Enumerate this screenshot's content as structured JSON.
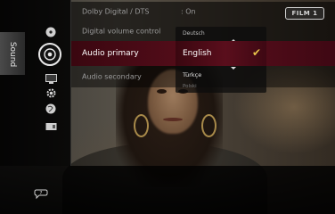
{
  "sidebar": {
    "label": "Sound",
    "categories": [
      {
        "icon": "disc-icon"
      },
      {
        "icon": "speaker-icon"
      },
      {
        "icon": "screen-icon"
      },
      {
        "icon": "gear-icon"
      },
      {
        "icon": "globe-icon"
      },
      {
        "icon": "device-icon"
      }
    ]
  },
  "settings": {
    "dolby_label": "Dolby Digital / DTS",
    "dolby_value": ": On",
    "dvc_label": "Digital volume control",
    "audio_primary_label": "Audio primary",
    "audio_secondary_label": "Audio secondary"
  },
  "dropdown": {
    "options": [
      "Deutsch",
      "English",
      "Türkçe",
      "Polski"
    ],
    "selected": "English",
    "check_icon": "checkmark-icon",
    "accent_color": "#e7c34a"
  },
  "logo": {
    "text": "FILM 1"
  },
  "footer": {
    "help_icon": "help-icon"
  },
  "colors": {
    "highlight": "#5a0e1c",
    "text_dim": "#9a9a9a",
    "text_bright": "#ffffff"
  }
}
